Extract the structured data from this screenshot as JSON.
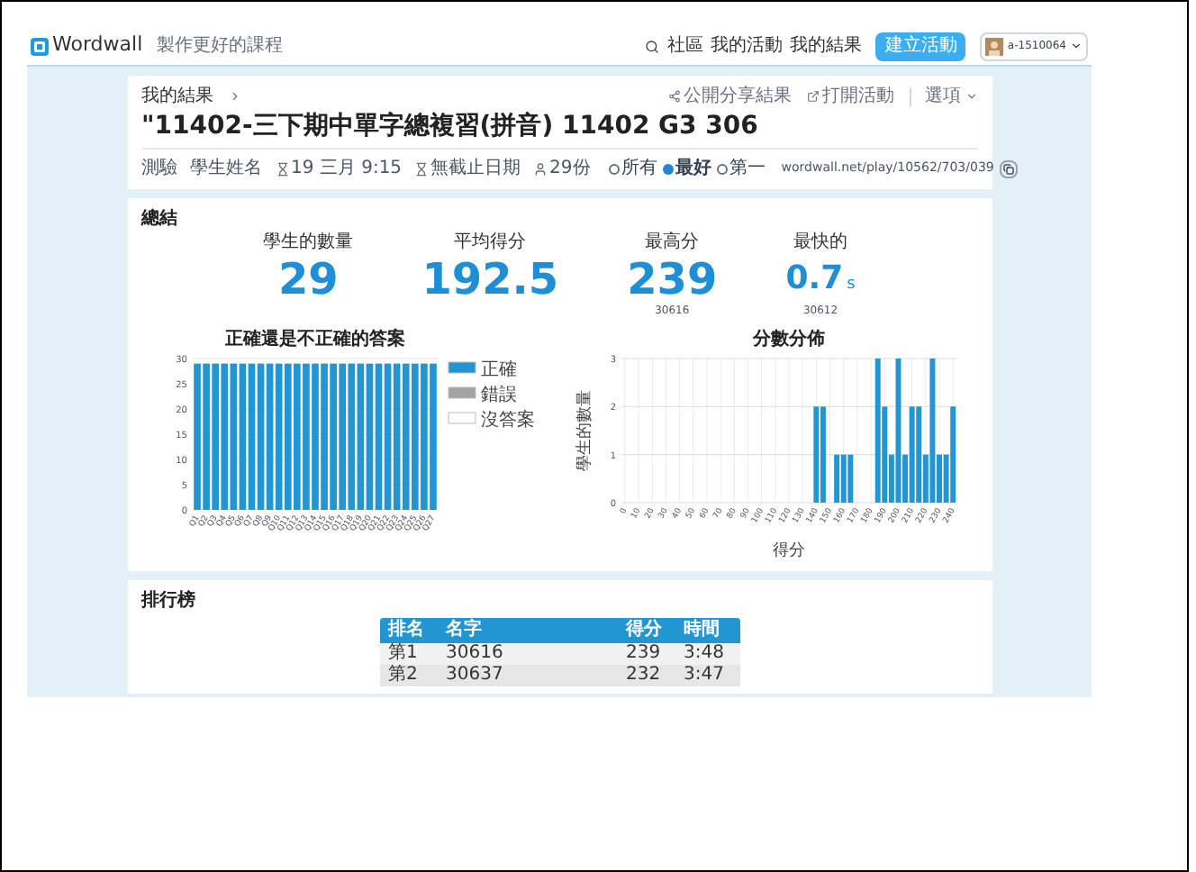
{
  "header": {
    "logo": "Wordwall",
    "tagline": "製作更好的課程",
    "nav": [
      "社區",
      "我的活動",
      "我的結果"
    ],
    "create_button": "建立活動",
    "user": "a-1510064"
  },
  "activity": {
    "breadcrumb": "我的結果",
    "title": "\"11402-三下期中單字總複習(拼音) 11402 G3 306",
    "actions": [
      "公開分享結果",
      "打開活動",
      "選項"
    ],
    "meta": [
      {
        "kind": "text",
        "text": "測驗"
      },
      {
        "kind": "text",
        "text": "學生姓名"
      },
      {
        "kind": "time",
        "text": "19 三月 9:15"
      },
      {
        "kind": "time",
        "text": "無截止日期"
      },
      {
        "kind": "user",
        "text": "29份"
      }
    ],
    "filters": [
      {
        "label": "所有",
        "selected": false
      },
      {
        "label": "最好",
        "selected": true
      },
      {
        "label": "第一",
        "selected": false
      }
    ],
    "link": "wordwall.net/play/10562/703/039"
  },
  "summary": {
    "title": "總結",
    "stats": [
      {
        "label": "學生的數量",
        "value": "29"
      },
      {
        "label": "平均得分",
        "value": "192.5"
      },
      {
        "label": "最高分",
        "value": "239",
        "sub": "30616"
      },
      {
        "label": "最快的",
        "value": "0.7",
        "unit": "s",
        "sub": "30612"
      }
    ]
  },
  "charts": [
    {
      "chart_data": {
        "type": "bar",
        "stacked": true,
        "grid": true,
        "title": "正確還是不正確的答案",
        "categories": [
          "Q1",
          "Q2",
          "Q3",
          "Q4",
          "Q5",
          "Q6",
          "Q7",
          "Q8",
          "Q9",
          "Q10",
          "Q11",
          "Q12",
          "Q13",
          "Q14",
          "Q15",
          "Q16",
          "Q17",
          "Q18",
          "Q19",
          "Q20",
          "Q21",
          "Q22",
          "Q23",
          "Q24",
          "Q25",
          "Q26",
          "Q27"
        ],
        "ylim": [
          0,
          30
        ],
        "yticks": [
          0,
          5,
          10,
          15,
          20,
          25,
          30
        ],
        "series": [
          {
            "name": "正確",
            "color": "#2196d3",
            "values": [
              29,
              29,
              29,
              29,
              29,
              29,
              29,
              29,
              29,
              29,
              29,
              29,
              29,
              29,
              29,
              29,
              29,
              29,
              29,
              29,
              29,
              29,
              29,
              29,
              29,
              29,
              29
            ]
          },
          {
            "name": "錯誤",
            "color": "#a3a3a3",
            "values": [
              0,
              0,
              0,
              0,
              0,
              0,
              0,
              0,
              0,
              0,
              0,
              0,
              0,
              0,
              0,
              0,
              0,
              0,
              0,
              0,
              0,
              0,
              0,
              0,
              0,
              0,
              0
            ]
          },
          {
            "name": "沒答案",
            "color": "#ffffff",
            "values": [
              0,
              0,
              0,
              0,
              0,
              0,
              0,
              0,
              0,
              0,
              0,
              0,
              0,
              0,
              0,
              0,
              0,
              0,
              0,
              0,
              0,
              0,
              0,
              0,
              0,
              0,
              0
            ]
          }
        ]
      }
    },
    {
      "chart_data": {
        "type": "bar",
        "grid": true,
        "title": "分數分佈",
        "xlabel": "得分",
        "ylabel": "學生的數量",
        "x": [
          0,
          5,
          10,
          15,
          20,
          25,
          30,
          35,
          40,
          45,
          50,
          55,
          60,
          65,
          70,
          75,
          80,
          85,
          90,
          95,
          100,
          105,
          110,
          115,
          120,
          125,
          130,
          135,
          140,
          145,
          150,
          155,
          160,
          165,
          170,
          175,
          180,
          185,
          190,
          195,
          200,
          205,
          210,
          215,
          220,
          225,
          230,
          235,
          240
        ],
        "xlim": [
          0,
          240
        ],
        "ylim": [
          0,
          3
        ],
        "yticks": [
          0,
          1,
          2,
          3
        ],
        "xticks": [
          0,
          10,
          20,
          30,
          40,
          50,
          60,
          70,
          80,
          90,
          100,
          110,
          120,
          130,
          140,
          150,
          160,
          170,
          180,
          190,
          200,
          210,
          220,
          230,
          240
        ],
        "series": [
          {
            "color": "#2196d3",
            "values": [
              0,
              0,
              0,
              0,
              0,
              0,
              0,
              0,
              0,
              0,
              0,
              0,
              0,
              0,
              0,
              0,
              0,
              0,
              0,
              0,
              0,
              0,
              0,
              0,
              0,
              0,
              0,
              0,
              2,
              2,
              0,
              1,
              1,
              1,
              0,
              0,
              0,
              3,
              2,
              1,
              3,
              1,
              2,
              2,
              1,
              3,
              1,
              1,
              2
            ]
          }
        ]
      }
    }
  ],
  "leaderboard": {
    "title": "排行榜",
    "columns": [
      "排名",
      "名字",
      "得分",
      "時間"
    ],
    "rows": [
      [
        "第1",
        "30616",
        "239",
        "3:48"
      ],
      [
        "第2",
        "30637",
        "232",
        "3:47"
      ]
    ]
  }
}
